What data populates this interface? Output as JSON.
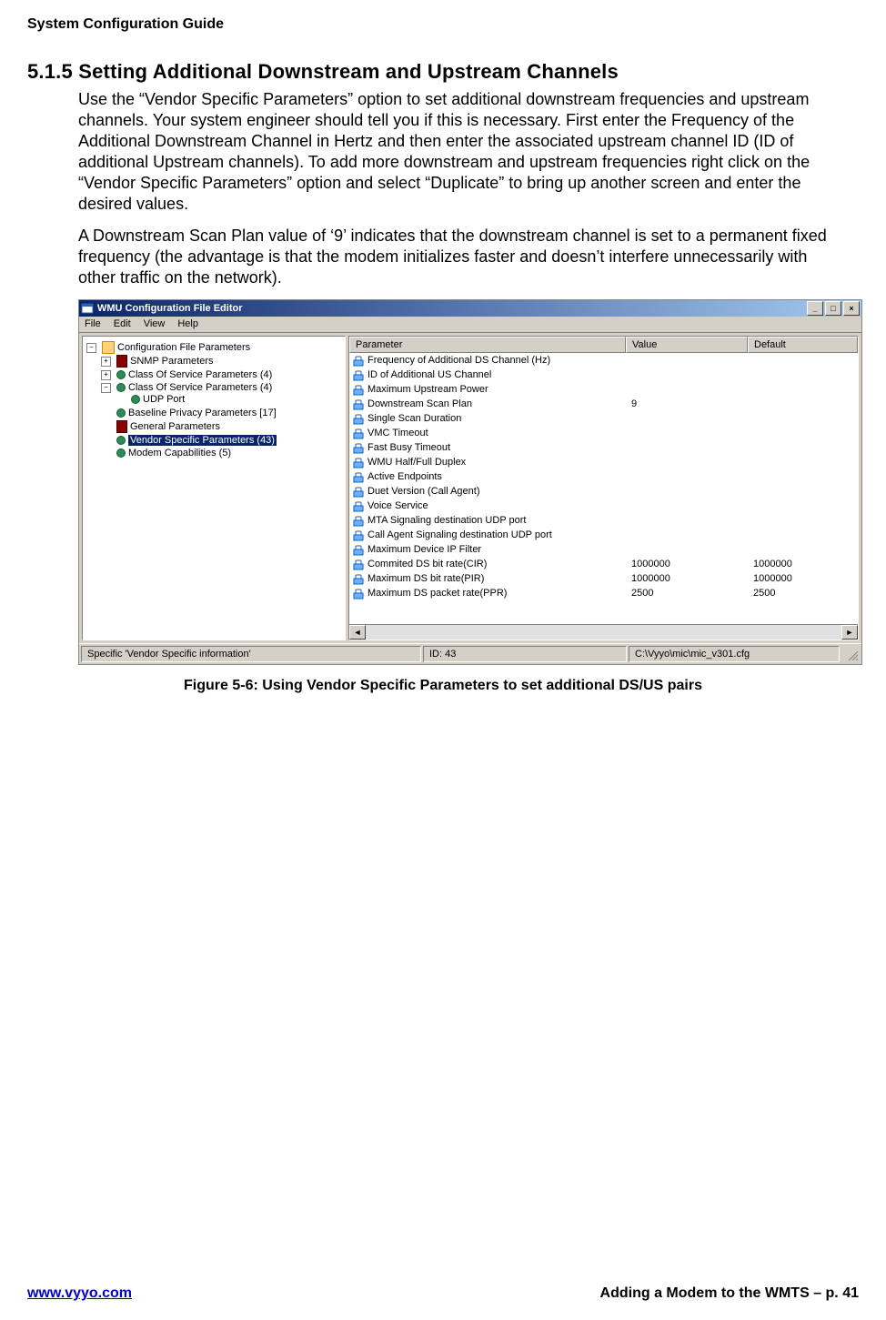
{
  "doc_title": "System Configuration Guide",
  "section": {
    "number": "5.1.5",
    "title": "Setting Additional Downstream and Upstream Channels"
  },
  "paragraphs": [
    "Use the “Vendor Specific Parameters” option to set additional downstream frequencies and upstream channels.  Your system engineer should tell you if this is necessary.  First enter the Frequency of the Additional Downstream Channel in Hertz and then enter the associated upstream channel ID (ID of additional Upstream channels).  To add more downstream and upstream frequencies right click on the “Vendor Specific Parameters” option and select “Duplicate” to bring up another screen and enter the desired values.",
    "A Downstream Scan Plan value of ‘9’ indicates that the downstream channel is set to a permanent fixed frequency (the advantage is that the modem initializes faster and doesn’t interfere unnecessarily with other traffic on the network)."
  ],
  "app": {
    "title": "WMU Configuration File Editor",
    "menu": [
      "File",
      "Edit",
      "View",
      "Help"
    ],
    "tree": {
      "root": "Configuration File Parameters",
      "children": [
        {
          "label": "SNMP Parameters",
          "expander": "+",
          "icon": "red"
        },
        {
          "label": "Class Of Service Parameters (4)",
          "expander": "+",
          "icon": "grn"
        },
        {
          "label": "Class Of Service Parameters (4)",
          "expander": "-",
          "icon": "grn",
          "children": [
            {
              "label": "UDP Port",
              "icon": "grn"
            }
          ]
        },
        {
          "label": "Baseline Privacy Parameters [17]",
          "icon": "grn"
        },
        {
          "label": "General Parameters",
          "icon": "red"
        },
        {
          "label": "Vendor Specific Parameters (43)",
          "icon": "grn",
          "selected": true
        },
        {
          "label": "Modem Capabilities (5)",
          "icon": "grn"
        }
      ]
    },
    "columns": [
      "Parameter",
      "Value",
      "Default"
    ],
    "rows": [
      {
        "param": "Frequency of Additional DS Channel (Hz)",
        "value": "",
        "default": ""
      },
      {
        "param": "ID of Additional US Channel",
        "value": "",
        "default": ""
      },
      {
        "param": "Maximum Upstream Power",
        "value": "",
        "default": ""
      },
      {
        "param": "Downstream Scan Plan",
        "value": "9",
        "default": ""
      },
      {
        "param": "Single Scan Duration",
        "value": "",
        "default": ""
      },
      {
        "param": "VMC Timeout",
        "value": "",
        "default": ""
      },
      {
        "param": "Fast Busy Timeout",
        "value": "",
        "default": ""
      },
      {
        "param": "WMU  Half/Full Duplex",
        "value": "",
        "default": ""
      },
      {
        "param": "Active Endpoints",
        "value": "",
        "default": ""
      },
      {
        "param": "Duet Version (Call Agent)",
        "value": "",
        "default": ""
      },
      {
        "param": "Voice Service",
        "value": "",
        "default": ""
      },
      {
        "param": "MTA Signaling destination UDP port",
        "value": "",
        "default": ""
      },
      {
        "param": "Call Agent Signaling destination UDP port",
        "value": "",
        "default": ""
      },
      {
        "param": "Maximum Device IP Filter",
        "value": "",
        "default": ""
      },
      {
        "param": "Commited DS bit rate(CIR)",
        "value": "1000000",
        "default": "1000000"
      },
      {
        "param": "Maximum DS bit rate(PIR)",
        "value": "1000000",
        "default": "1000000"
      },
      {
        "param": "Maximum DS packet rate(PPR)",
        "value": "2500",
        "default": "2500"
      }
    ],
    "status": {
      "left": "Specific 'Vendor Specific information'",
      "mid": "ID: 43",
      "right": "C:\\Vyyo\\mic\\mic_v301.cfg"
    }
  },
  "figure_caption": "Figure 5-6: Using Vendor Specific Parameters to set additional DS/US pairs",
  "footer": {
    "left_url": "www.vyyo.com",
    "right": "Adding a Modem to the WMTS – p. 41"
  }
}
